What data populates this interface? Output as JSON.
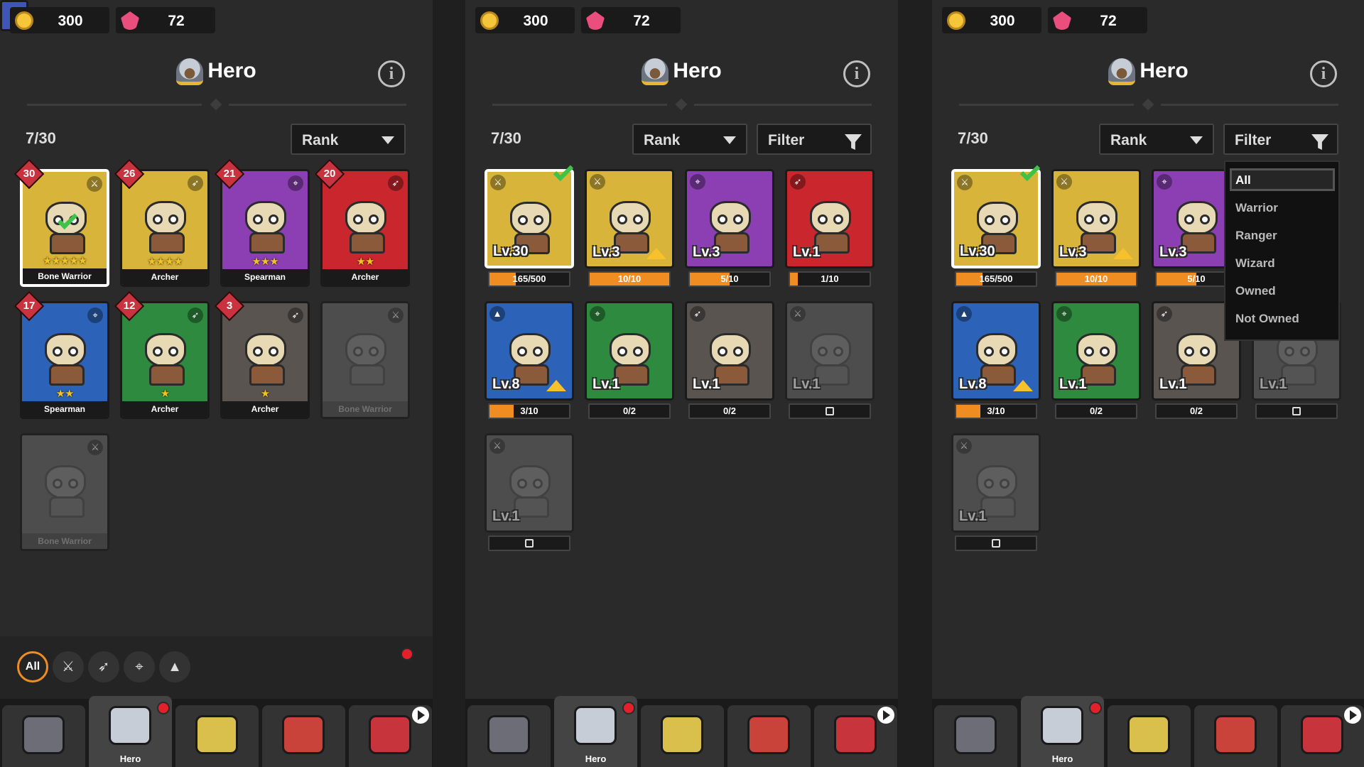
{
  "currency": {
    "gold": "300",
    "gems": "72"
  },
  "header": {
    "title": "Hero",
    "info_icon": "info-icon"
  },
  "count": "7/30",
  "controls": {
    "sort_label": "Rank",
    "filter_label": "Filter"
  },
  "colors": {
    "yellow": "#d8b43a",
    "purple": "#8b3fb2",
    "red": "#c9262d",
    "blue": "#2c63b8",
    "green": "#2e8a3e",
    "gray": "#5a5450",
    "locked": "#6b6b6b",
    "progress": "#f08d22",
    "accent": "#f08d22"
  },
  "panel1": {
    "cards": [
      {
        "rank": "30",
        "name": "Bone Warrior",
        "stars": "★★★★★",
        "color": "yellow",
        "class_icon": "sword-icon",
        "selected": true
      },
      {
        "rank": "26",
        "name": "Archer",
        "stars": "★★★★",
        "color": "yellow",
        "class_icon": "bow-icon"
      },
      {
        "rank": "21",
        "name": "Spearman",
        "stars": "★★★",
        "color": "purple",
        "class_icon": "crosshair-icon"
      },
      {
        "rank": "20",
        "name": "Archer",
        "stars": "★★",
        "color": "red",
        "class_icon": "bow-icon"
      },
      {
        "rank": "17",
        "name": "Spearman",
        "stars": "★★",
        "color": "blue",
        "class_icon": "crosshair-icon"
      },
      {
        "rank": "12",
        "name": "Archer",
        "stars": "★",
        "color": "green",
        "class_icon": "bow-icon"
      },
      {
        "rank": "3",
        "name": "Archer",
        "stars": "★",
        "color": "gray",
        "class_icon": "bow-icon"
      },
      {
        "rank": "",
        "name": "Bone Warrior",
        "stars": "",
        "color": "locked",
        "class_icon": "sword-icon"
      },
      {
        "rank": "",
        "name": "Bone Warrior",
        "stars": "",
        "color": "locked",
        "class_icon": "sword-icon"
      }
    ],
    "filter_chips": [
      "All",
      "sword-icon",
      "bow-icon",
      "crosshair-icon",
      "wizard-hat-icon"
    ]
  },
  "level_cards": [
    {
      "level": "Lv.30",
      "progress": "165/500",
      "fraction": 0.33,
      "color": "yellow",
      "class_icon": "sword-icon",
      "upgrade": false
    },
    {
      "level": "Lv.3",
      "progress": "10/10",
      "fraction": 1.0,
      "color": "yellow",
      "class_icon": "sword-icon",
      "upgrade": true
    },
    {
      "level": "Lv.3",
      "progress": "5/10",
      "fraction": 0.5,
      "color": "purple",
      "class_icon": "crosshair-icon",
      "upgrade": false
    },
    {
      "level": "Lv.1",
      "progress": "1/10",
      "fraction": 0.1,
      "color": "red",
      "class_icon": "bow-icon",
      "upgrade": false
    },
    {
      "level": "Lv.8",
      "progress": "3/10",
      "fraction": 0.3,
      "color": "blue",
      "class_icon": "wizard-hat-icon",
      "upgrade": true
    },
    {
      "level": "Lv.1",
      "progress": "0/2",
      "fraction": 0,
      "color": "green",
      "class_icon": "crosshair-icon",
      "upgrade": false
    },
    {
      "level": "Lv.1",
      "progress": "0/2",
      "fraction": 0,
      "color": "gray",
      "class_icon": "bow-icon",
      "upgrade": false
    },
    {
      "level": "Lv.1",
      "progress": "",
      "fraction": 0,
      "color": "locked",
      "class_icon": "sword-icon",
      "upgrade": false,
      "locked": true
    },
    {
      "level": "Lv.1",
      "progress": "",
      "fraction": 0,
      "color": "locked",
      "class_icon": "sword-icon",
      "upgrade": false,
      "locked": true
    }
  ],
  "filter_menu": {
    "items": [
      "All",
      "Warrior",
      "Ranger",
      "Wizard",
      "Owned",
      "Not Owned"
    ],
    "selected": "All"
  },
  "nav": {
    "tabs": [
      {
        "icon": "castle-gate-icon",
        "label": ""
      },
      {
        "icon": "knight-helmet-icon",
        "label": "Hero",
        "active": true,
        "badge": true
      },
      {
        "icon": "crossed-swords-icon",
        "label": ""
      },
      {
        "icon": "spellbook-icon",
        "label": ""
      },
      {
        "icon": "shop-icon",
        "label": ""
      }
    ]
  }
}
